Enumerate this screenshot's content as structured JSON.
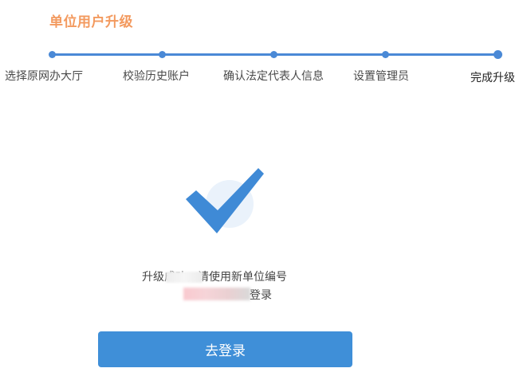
{
  "page": {
    "title": "单位用户升级"
  },
  "steps": [
    {
      "label": "选择原网办大厅"
    },
    {
      "label": "校验历史账户"
    },
    {
      "label": "确认法定代表人信息"
    },
    {
      "label": "设置管理员"
    },
    {
      "label": "完成升级"
    }
  ],
  "current_step": 5,
  "colors": {
    "accent": "#4a89d6",
    "title": "#f39a5f",
    "button": "#3f8fd8",
    "check": "#3f8ad6"
  },
  "result": {
    "icon": "check-icon",
    "line1": "升级成功，请使用新单位编号",
    "line2_suffix": "登录"
  },
  "login_button": {
    "label": "去登录"
  }
}
